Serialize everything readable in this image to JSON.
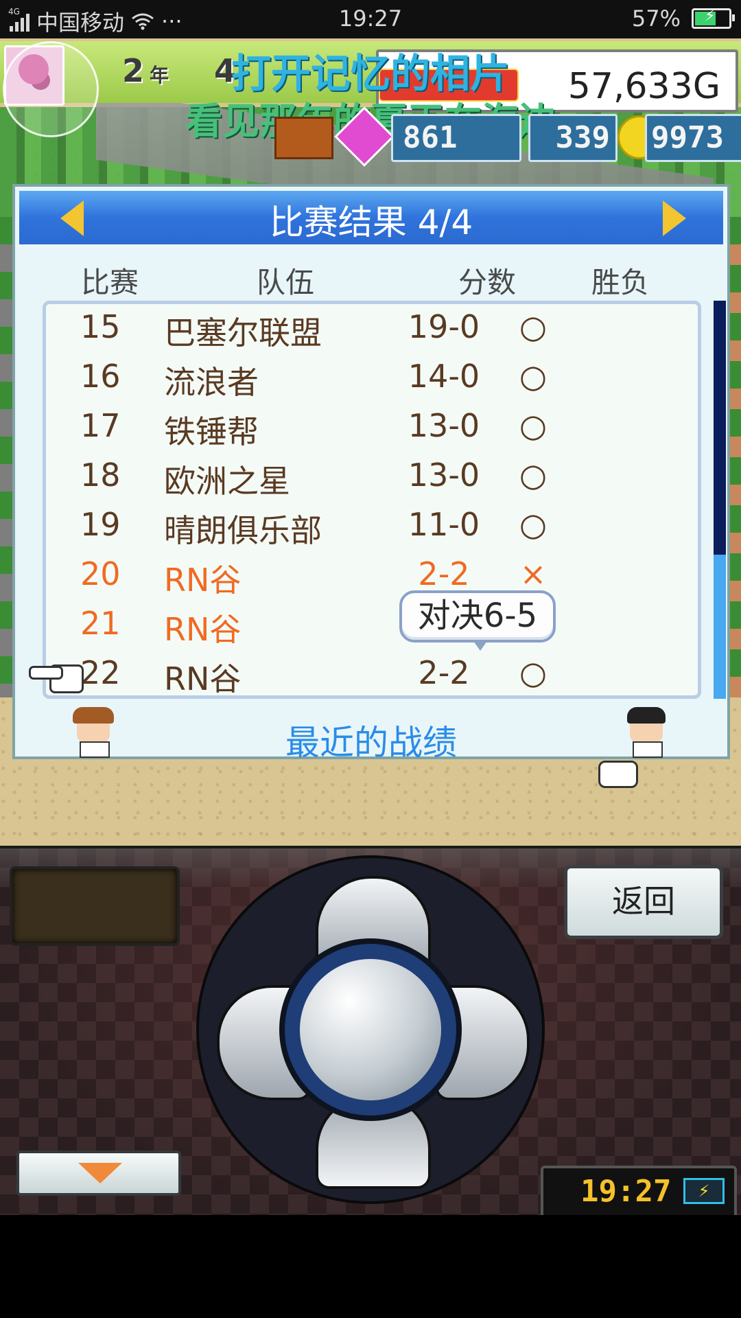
{
  "status_bar": {
    "network_tag": "4G",
    "carrier": "中国移动",
    "more": "···",
    "time": "19:27",
    "battery": "57%"
  },
  "hud": {
    "year_num": "2",
    "year_label": "年",
    "month_num": "4",
    "money": "57,633G",
    "stat_1": "861",
    "stat_2": "339",
    "stat_3": "9973"
  },
  "lyrics": {
    "line1": "打开记忆的相片",
    "line2": "看见那年的夏天在海边"
  },
  "results": {
    "title": "比赛结果 4/4",
    "headers": {
      "match": "比赛",
      "team": "队伍",
      "score": "分数",
      "result": "胜负"
    },
    "rows": [
      {
        "num": "15",
        "team": "巴塞尔联盟",
        "score": "19-0",
        "result": "○"
      },
      {
        "num": "16",
        "team": "流浪者",
        "score": "14-0",
        "result": "○"
      },
      {
        "num": "17",
        "team": "铁锤帮",
        "score": "13-0",
        "result": "○"
      },
      {
        "num": "18",
        "team": "欧洲之星",
        "score": "13-0",
        "result": "○"
      },
      {
        "num": "19",
        "team": "晴朗俱乐部",
        "score": "11-0",
        "result": "○"
      },
      {
        "num": "20",
        "team": "RN谷",
        "score": "2-2",
        "result": "×"
      },
      {
        "num": "21",
        "team": "RN谷",
        "score": "",
        "result": "×"
      },
      {
        "num": "22",
        "team": "RN谷",
        "score": "2-2",
        "result": "○"
      }
    ],
    "bubble": "对决6-5",
    "recent_label": "最近的战绩"
  },
  "controls": {
    "back_label": "返回",
    "clock_time": "19:27"
  },
  "colors": {
    "header_blue": "#2f73dc",
    "lose_orange": "#f06a22",
    "recent_blue": "#2a8ce8",
    "arrow_yellow": "#f3c531"
  }
}
